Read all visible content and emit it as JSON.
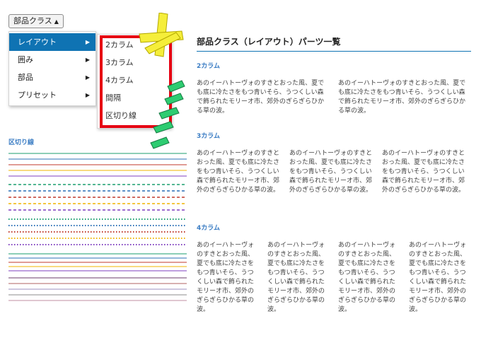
{
  "dropdown": {
    "label": "部品クラス",
    "caret": "▲"
  },
  "menu": {
    "items": [
      {
        "label": "レイアウト"
      },
      {
        "label": "囲み"
      },
      {
        "label": "部品"
      },
      {
        "label": "プリセット"
      }
    ],
    "arrow": "▶"
  },
  "submenu": {
    "items": [
      {
        "label": "2カラム"
      },
      {
        "label": "3カラム"
      },
      {
        "label": "4カラム"
      },
      {
        "label": "間隔"
      },
      {
        "label": "区切り線"
      }
    ]
  },
  "separator_panel": {
    "title": "区切り線"
  },
  "content": {
    "title": "部品クラス（レイアウト）パーツ一覧",
    "sections": [
      {
        "title": "2カラム",
        "columns": [
          "あのイーハトーヴォのすきとおった風、夏でも底に冷たさをもつ青いそら、うつくしい森で飾られたモリーオ市、郊外のぎらぎらひかる草の波。",
          "あのイーハトーヴォのすきとおった風、夏でも底に冷たさをもつ青いそら、うつくしい森で飾られたモリーオ市、郊外のぎらぎらひかる草の波。"
        ]
      },
      {
        "title": "3カラム",
        "columns": [
          "あのイーハトーヴォのすきとおった風、夏でも底に冷たさをもつ青いそら、うつくしい森で飾られたモリーオ市、郊外のぎらぎらひかる草の波。",
          "あのイーハトーヴォのすきとおった風、夏でも底に冷たさをもつ青いそら、うつくしい森で飾られたモリーオ市、郊外のぎらぎらひかる草の波。",
          "あのイーハトーヴォのすきとおった風、夏でも底に冷たさをもつ青いそら、うつくしい森で飾られたモリーオ市、郊外のぎらぎらひかる草の波。"
        ]
      },
      {
        "title": "4カラム",
        "columns": [
          "あのイーハトーヴォのすきとおった風、夏でも底に冷たさをもつ青いそら、うつくしい森で飾られたモリーオ市、郊外のぎらぎらひかる草の波。",
          "あのイーハトーヴォのすきとおった風、夏でも底に冷たさをもつ青いそら、うつくしい森で飾られたモリーオ市、郊外のぎらぎらひかる草の波。",
          "あのイーハトーヴォのすきとおった風、夏でも底に冷たさをもつ青いそら、うつくしい森で飾られたモリーオ市、郊外のぎらぎらひかる草の波。",
          "あのイーハトーヴォのすきとおった風、夏でも底に冷たさをもつ青いそら、うつくしい森で飾られたモリーオ市、郊外のぎらぎらひかる草の波。"
        ]
      }
    ]
  },
  "colors": {
    "accent": "#0f73b3",
    "highlight_border": "#e60012",
    "heading_blue": "#3b7dc4",
    "deco_yellow": "#f5ee3a",
    "deco_green": "#2ecc71"
  },
  "separator_colors": [
    "#1a9e6e",
    "#2a6fb5",
    "#c0392b",
    "#f0b400",
    "#7f3fbf"
  ]
}
